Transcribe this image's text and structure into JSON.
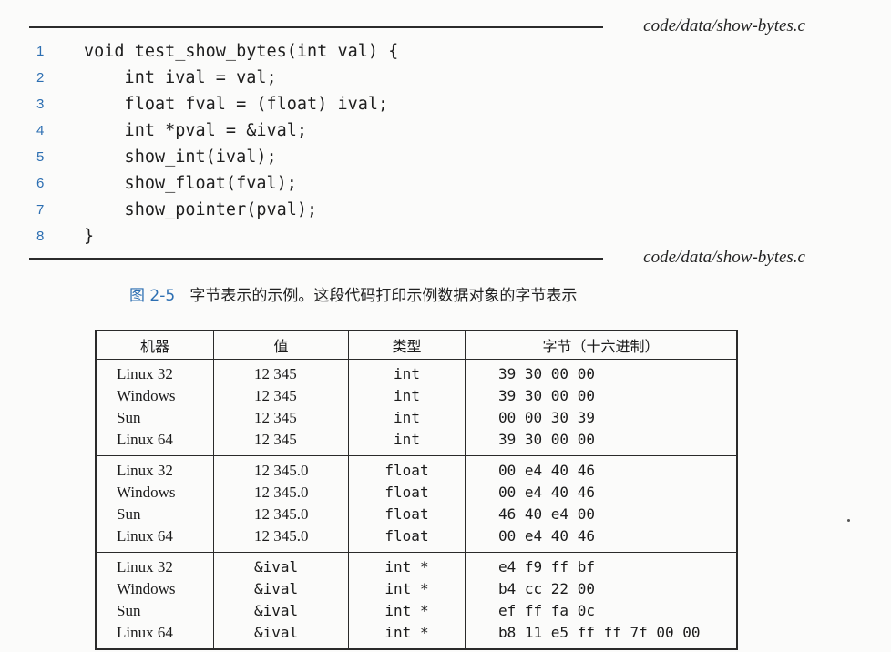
{
  "file_label": "code/data/show-bytes.c",
  "code_lines": [
    {
      "num": "1",
      "text": "void test_show_bytes(int val) {"
    },
    {
      "num": "2",
      "text": "    int ival = val;"
    },
    {
      "num": "3",
      "text": "    float fval = (float) ival;"
    },
    {
      "num": "4",
      "text": "    int *pval = &ival;"
    },
    {
      "num": "5",
      "text": "    show_int(ival);"
    },
    {
      "num": "6",
      "text": "    show_float(fval);"
    },
    {
      "num": "7",
      "text": "    show_pointer(pval);"
    },
    {
      "num": "8",
      "text": "}"
    }
  ],
  "caption": {
    "figure": "图 2-5",
    "text": "字节表示的示例。这段代码打印示例数据对象的字节表示"
  },
  "table": {
    "headers": [
      "机器",
      "值",
      "类型",
      "字节（十六进制）"
    ],
    "groups": [
      [
        [
          "Linux 32",
          "12 345",
          "int",
          "39 30 00 00"
        ],
        [
          "Windows",
          "12 345",
          "int",
          "39 30 00 00"
        ],
        [
          "Sun",
          "12 345",
          "int",
          "00 00 30 39"
        ],
        [
          "Linux 64",
          "12 345",
          "int",
          "39 30 00 00"
        ]
      ],
      [
        [
          "Linux 32",
          "12 345.0",
          "float",
          "00 e4 40 46"
        ],
        [
          "Windows",
          "12 345.0",
          "float",
          "00 e4 40 46"
        ],
        [
          "Sun",
          "12 345.0",
          "float",
          "46 40 e4 00"
        ],
        [
          "Linux 64",
          "12 345.0",
          "float",
          "00 e4 40 46"
        ]
      ],
      [
        [
          "Linux 32",
          "&ival",
          "int *",
          "e4 f9 ff bf"
        ],
        [
          "Windows",
          "&ival",
          "int *",
          "b4 cc 22 00"
        ],
        [
          "Sun",
          "&ival",
          "int *",
          "ef ff fa 0c"
        ],
        [
          "Linux 64",
          "&ival",
          "int *",
          "b8 11 e5 ff ff 7f 00 00"
        ]
      ]
    ]
  }
}
